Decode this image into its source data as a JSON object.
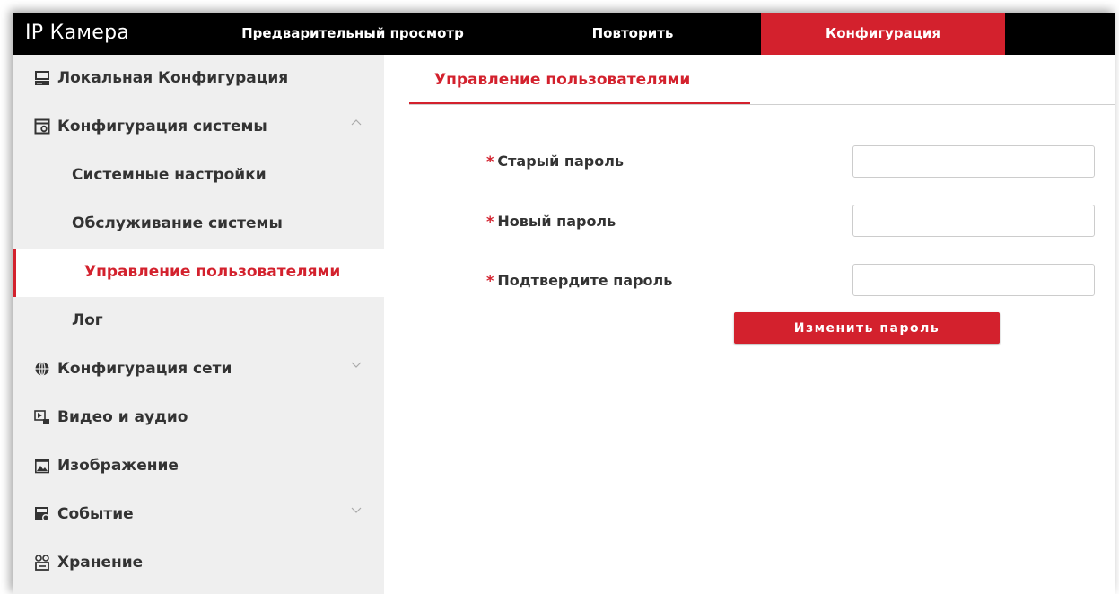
{
  "header": {
    "app_title": "IP Камера",
    "nav": {
      "preview": "Предварительный просмотр",
      "playback": "Повторить",
      "config": "Конфигурация"
    },
    "accent_color": "#d3212d"
  },
  "sidebar": {
    "local_config": "Локальная Конфигурация",
    "system_config": "Конфигурация системы",
    "system_settings": "Системные настройки",
    "maintenance": "Обслуживание системы",
    "user_management": "Управление пользователями",
    "log": "Лог",
    "network_config": "Конфигурация сети",
    "video_audio": "Видео и аудио",
    "image": "Изображение",
    "event": "Событие",
    "storage": "Хранение"
  },
  "content": {
    "tab_label": "Управление пользователями",
    "required_mark": "*",
    "old_password_label": "Старый пароль",
    "new_password_label": "Новый пароль",
    "confirm_password_label": "Подтвердите пароль",
    "old_password_value": "",
    "new_password_value": "",
    "confirm_password_value": "",
    "change_button": "Изменить пароль"
  }
}
